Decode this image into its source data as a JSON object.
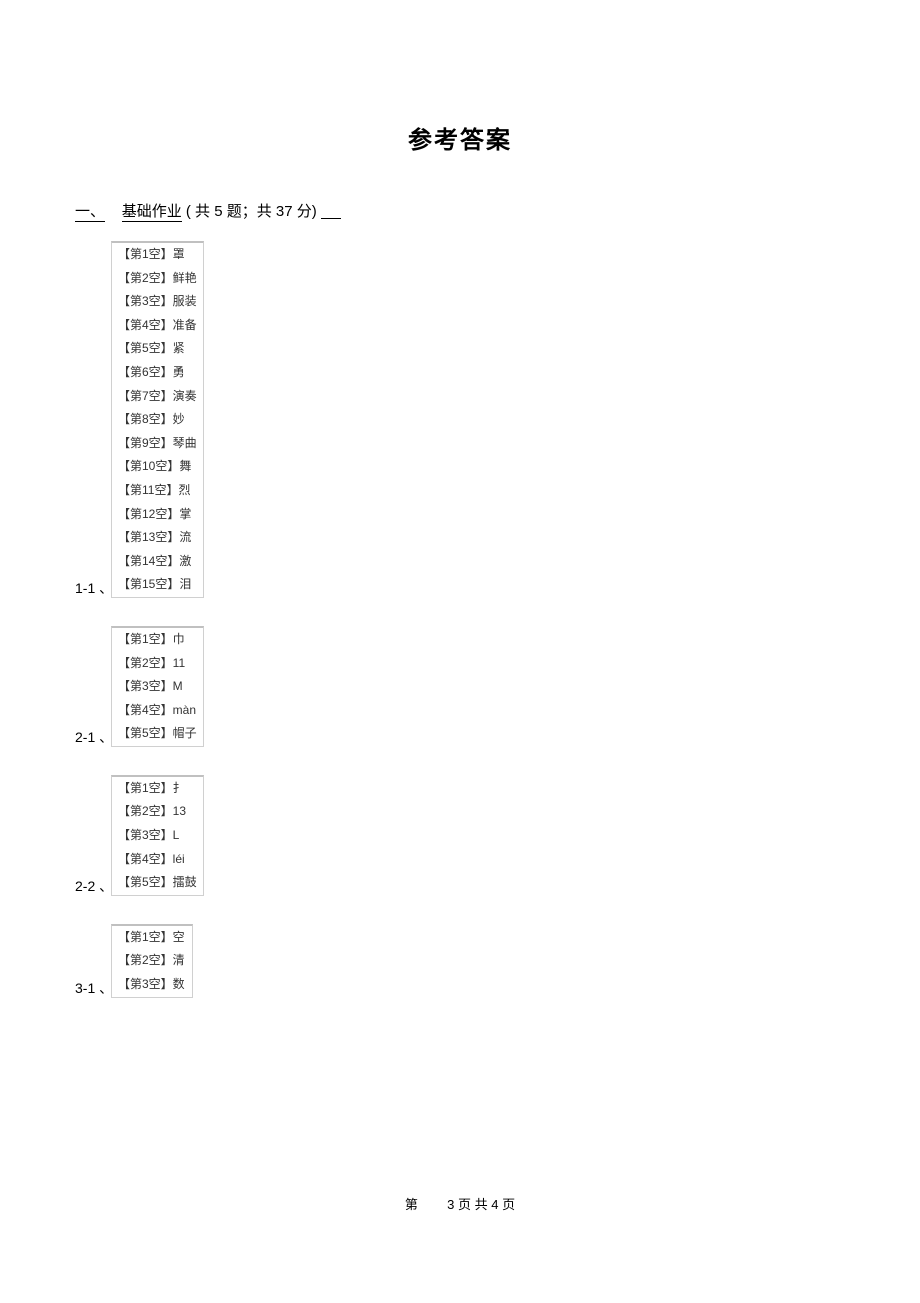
{
  "title": "参考答案",
  "section": {
    "number": "一、",
    "label": "基础作业",
    "counts": "( 共 5 题；共 37 分)"
  },
  "groups": [
    {
      "label": "1-1 、",
      "rows": [
        "【第1空】罩",
        "【第2空】鲜艳",
        "【第3空】服装",
        "【第4空】准备",
        "【第5空】紧",
        "【第6空】勇",
        "【第7空】演奏",
        "【第8空】妙",
        "【第9空】琴曲",
        "【第10空】舞",
        "【第11空】烈",
        "【第12空】掌",
        "【第13空】流",
        "【第14空】激",
        "【第15空】泪"
      ]
    },
    {
      "label": "2-1 、",
      "rows": [
        "【第1空】巾",
        "【第2空】11",
        "【第3空】M",
        "【第4空】màn",
        "【第5空】帽子"
      ]
    },
    {
      "label": "2-2 、",
      "rows": [
        "【第1空】扌",
        "【第2空】13",
        "【第3空】L",
        "【第4空】léi",
        "【第5空】擂鼓"
      ]
    },
    {
      "label": "3-1 、",
      "rows": [
        "【第1空】空",
        "【第2空】清",
        "【第3空】数"
      ]
    }
  ],
  "footer": {
    "prefix": "第",
    "text": "3 页 共 4 页"
  }
}
